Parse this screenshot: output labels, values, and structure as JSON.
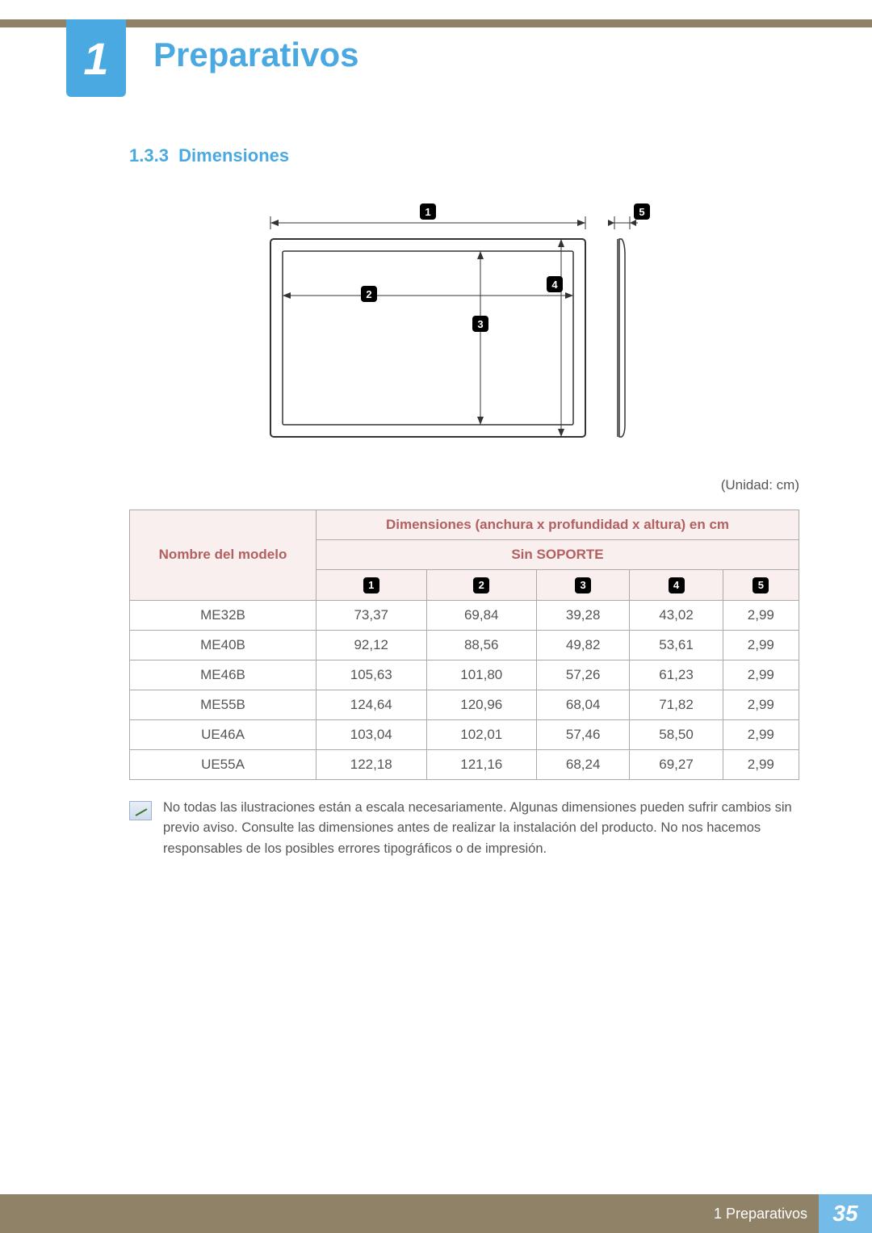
{
  "chapter": {
    "number": "1",
    "title": "Preparativos"
  },
  "section": {
    "number": "1.3.3",
    "title": "Dimensiones"
  },
  "diagram": {
    "unit_label": "(Unidad: cm)"
  },
  "table": {
    "model_header": "Nombre del modelo",
    "dims_header": "Dimensiones (anchura x profundidad x altura) en cm",
    "sub_header": "Sin SOPORTE",
    "rows": [
      {
        "model": "ME32B",
        "v": [
          "73,37",
          "69,84",
          "39,28",
          "43,02",
          "2,99"
        ]
      },
      {
        "model": "ME40B",
        "v": [
          "92,12",
          "88,56",
          "49,82",
          "53,61",
          "2,99"
        ]
      },
      {
        "model": "ME46B",
        "v": [
          "105,63",
          "101,80",
          "57,26",
          "61,23",
          "2,99"
        ]
      },
      {
        "model": "ME55B",
        "v": [
          "124,64",
          "120,96",
          "68,04",
          "71,82",
          "2,99"
        ]
      },
      {
        "model": "UE46A",
        "v": [
          "103,04",
          "102,01",
          "57,46",
          "58,50",
          "2,99"
        ]
      },
      {
        "model": "UE55A",
        "v": [
          "122,18",
          "121,16",
          "68,24",
          "69,27",
          "2,99"
        ]
      }
    ]
  },
  "note": "No todas las ilustraciones están a escala necesariamente. Algunas dimensiones pueden sufrir cambios sin previo aviso. Consulte las dimensiones antes de realizar la instalación del producto. No nos hacemos responsables de los posibles errores tipográficos o de impresión.",
  "footer": {
    "text": "1 Preparativos",
    "page": "35"
  }
}
